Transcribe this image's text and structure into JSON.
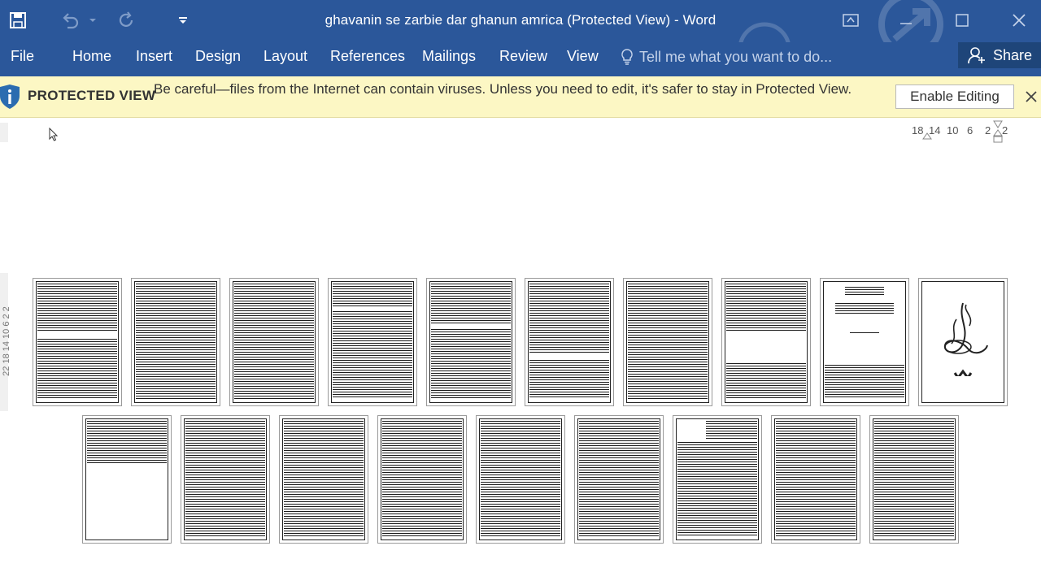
{
  "window": {
    "title": "ghavanin se zarbie dar ghanun amrica (Protected View) - Word",
    "colors": {
      "ribbon": "#2b579a",
      "protected_bar": "#fcf7c4"
    }
  },
  "qat": {
    "icons": [
      "save-icon",
      "undo-icon",
      "dropdown-icon",
      "redo-icon",
      "customize-icon"
    ]
  },
  "window_controls": [
    "ribbon-display-icon",
    "minimize-icon",
    "maximize-icon",
    "close-icon"
  ],
  "ribbon": {
    "tabs": [
      "File",
      "Home",
      "Insert",
      "Design",
      "Layout",
      "References",
      "Mailings",
      "Review",
      "View"
    ],
    "tell_me": "Tell me what you want to do...",
    "share": "Share"
  },
  "protected_view": {
    "title": "PROTECTED VIEW",
    "message": "Be careful—files from the Internet can contain viruses. Unless you need to edit, it's safer to stay in Protected View.",
    "enable_button": "Enable Editing"
  },
  "ruler": {
    "horizontal_ticks": [
      "18",
      "14",
      "10",
      "6",
      "2",
      "2"
    ],
    "vertical_text": "22 18 14 10 6 2 2"
  },
  "document": {
    "page_count": 19
  }
}
